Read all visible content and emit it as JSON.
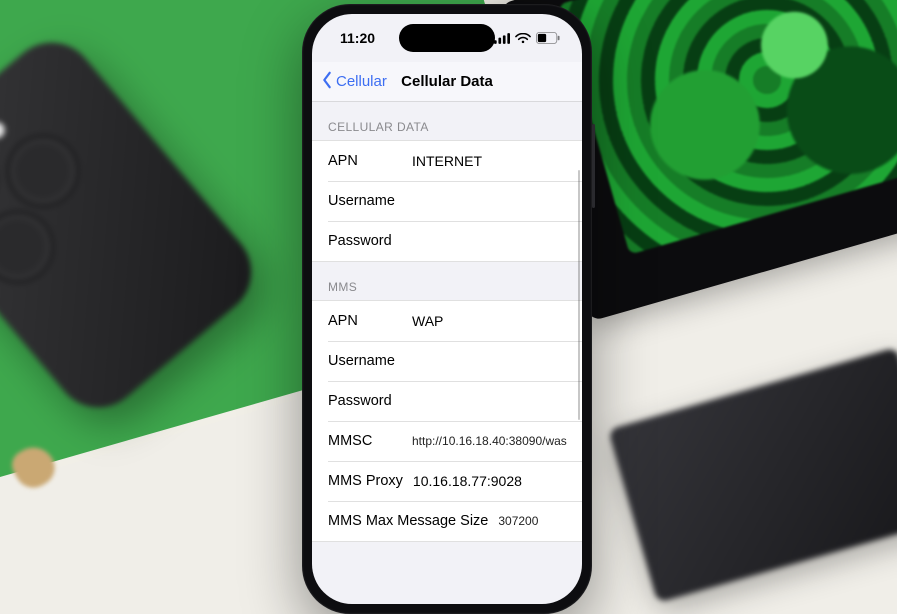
{
  "colors": {
    "accent": "#3d6ef2",
    "bg": "#f2f2f7",
    "groupText": "#8a8a8e"
  },
  "statusBar": {
    "time": "11:20",
    "icons": {
      "signal": "signal-icon",
      "wifi": "wifi-icon",
      "battery": "battery-icon"
    }
  },
  "nav": {
    "back": "Cellular",
    "title": "Cellular Data"
  },
  "groups": [
    {
      "header": "CELLULAR DATA",
      "rows": [
        {
          "label": "APN",
          "value": "INTERNET"
        },
        {
          "label": "Username",
          "value": ""
        },
        {
          "label": "Password",
          "value": ""
        }
      ]
    },
    {
      "header": "MMS",
      "rows": [
        {
          "label": "APN",
          "value": "WAP"
        },
        {
          "label": "Username",
          "value": ""
        },
        {
          "label": "Password",
          "value": ""
        },
        {
          "label": "MMSC",
          "value": "http://10.16.18.40:38090/was"
        },
        {
          "label": "MMS Proxy",
          "value": "10.16.18.77:9028"
        },
        {
          "label": "MMS Max Message Size",
          "value": "307200"
        }
      ]
    }
  ]
}
